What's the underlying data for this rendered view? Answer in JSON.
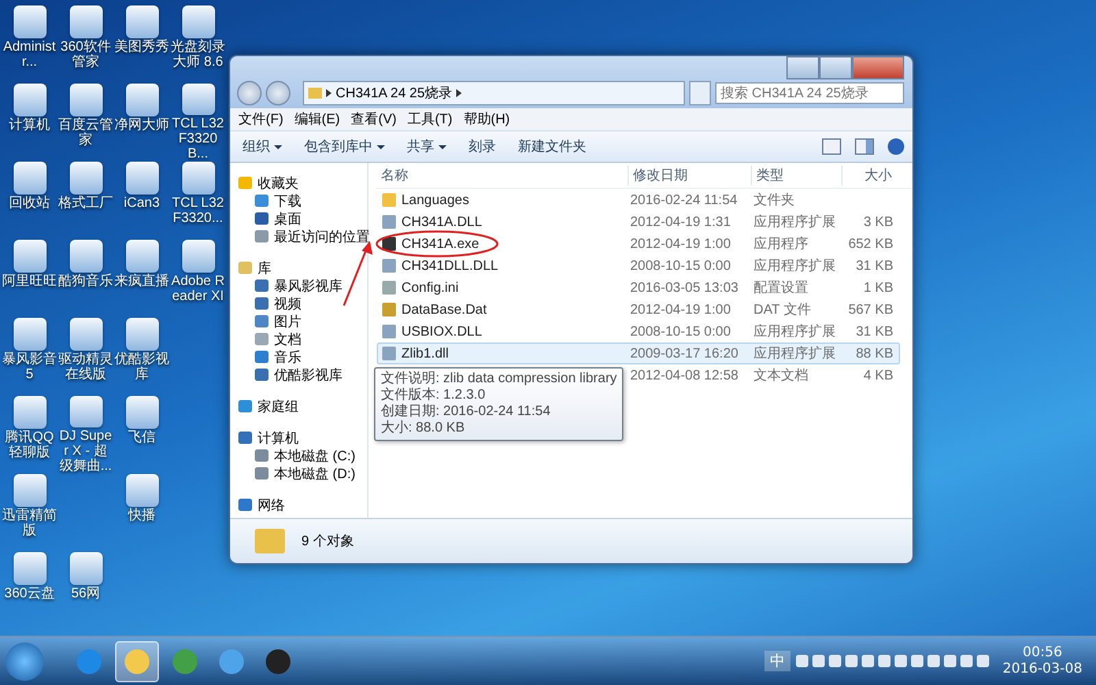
{
  "desktop": {
    "icons": [
      {
        "kind": "app",
        "label": "Administr..."
      },
      {
        "kind": "app",
        "label": "计算机"
      },
      {
        "kind": "app",
        "label": "回收站"
      },
      {
        "kind": "app",
        "label": "阿里旺旺"
      },
      {
        "kind": "app",
        "label": "暴风影音5"
      },
      {
        "kind": "app",
        "label": "腾讯QQ轻聊版"
      },
      {
        "kind": "app",
        "label": "迅雷精简版"
      },
      {
        "kind": "app",
        "label": "360云盘"
      },
      {
        "kind": "app",
        "label": "360软件管家"
      },
      {
        "kind": "app",
        "label": "百度云管家"
      },
      {
        "kind": "app",
        "label": "格式工厂"
      },
      {
        "kind": "app",
        "label": "酷狗音乐"
      },
      {
        "kind": "app",
        "label": "驱动精灵在线版"
      },
      {
        "kind": "app",
        "label": "DJ Super X - 超级舞曲..."
      },
      {
        "kind": "blank"
      },
      {
        "kind": "app",
        "label": "56网"
      },
      {
        "kind": "app",
        "label": "美图秀秀"
      },
      {
        "kind": "app",
        "label": "净网大师"
      },
      {
        "kind": "app",
        "label": "iCan3"
      },
      {
        "kind": "app",
        "label": "来疯直播"
      },
      {
        "kind": "app",
        "label": "优酷影视库"
      },
      {
        "kind": "app",
        "label": "飞信"
      },
      {
        "kind": "app",
        "label": "快播"
      },
      {
        "kind": "blank"
      },
      {
        "kind": "app",
        "label": "光盘刻录大师 8.6"
      },
      {
        "kind": "app",
        "label": "TCL L32F3320B..."
      },
      {
        "kind": "app",
        "label": "TCL L32F3320..."
      },
      {
        "kind": "app",
        "label": "Adobe Reader XI"
      }
    ]
  },
  "window": {
    "address": "CH341A 24 25烧录",
    "search": {
      "placeholder": "搜索 CH341A 24 25烧录"
    },
    "menu": [
      "文件(F)",
      "编辑(E)",
      "查看(V)",
      "工具(T)",
      "帮助(H)"
    ],
    "toolbar": [
      {
        "label": "组织",
        "dropdown": true
      },
      {
        "label": "包含到库中",
        "dropdown": true
      },
      {
        "label": "共享",
        "dropdown": true
      },
      {
        "label": "刻录",
        "dropdown": false
      },
      {
        "label": "新建文件夹",
        "dropdown": false
      }
    ],
    "sidebar": [
      {
        "label": "收藏夹",
        "kind": "star",
        "children": [
          {
            "label": "下载",
            "kind": "download"
          },
          {
            "label": "桌面",
            "kind": "desktop"
          },
          {
            "label": "最近访问的位置",
            "kind": "recent"
          }
        ]
      },
      {
        "label": "库",
        "kind": "library",
        "children": [
          {
            "label": "暴风影视库",
            "kind": "video"
          },
          {
            "label": "视频",
            "kind": "video"
          },
          {
            "label": "图片",
            "kind": "picture"
          },
          {
            "label": "文档",
            "kind": "doc"
          },
          {
            "label": "音乐",
            "kind": "music"
          },
          {
            "label": "优酷影视库",
            "kind": "video"
          }
        ]
      },
      {
        "label": "家庭组",
        "kind": "homegroup"
      },
      {
        "label": "计算机",
        "kind": "computer",
        "children": [
          {
            "label": "本地磁盘 (C:)",
            "kind": "drive"
          },
          {
            "label": "本地磁盘 (D:)",
            "kind": "drive"
          }
        ]
      },
      {
        "label": "网络",
        "kind": "network"
      }
    ],
    "columns": [
      "名称",
      "修改日期",
      "类型",
      "大小"
    ],
    "files": [
      {
        "name": "Languages",
        "date": "2016-02-24 11:54",
        "type": "文件夹",
        "kind": "folder",
        "selected": false
      },
      {
        "name": "CH341A.DLL",
        "date": "2012-04-19 1:31",
        "type": "应用程序扩展",
        "size": "3 KB",
        "kind": "dll",
        "selected": false
      },
      {
        "name": "CH341A.exe",
        "date": "2012-04-19 1:00",
        "type": "应用程序",
        "size": "652 KB",
        "kind": "exe",
        "selected": false
      },
      {
        "name": "CH341DLL.DLL",
        "date": "2008-10-15 0:00",
        "type": "应用程序扩展",
        "size": "31 KB",
        "kind": "dll",
        "selected": false
      },
      {
        "name": "Config.ini",
        "date": "2016-03-05 13:03",
        "type": "配置设置",
        "size": "1 KB",
        "kind": "ini",
        "selected": false
      },
      {
        "name": "DataBase.Dat",
        "date": "2012-04-19 1:00",
        "type": "DAT 文件",
        "size": "567 KB",
        "kind": "dat",
        "selected": false
      },
      {
        "name": "USBIOX.DLL",
        "date": "2008-10-15 0:00",
        "type": "应用程序扩展",
        "size": "31 KB",
        "kind": "dll",
        "selected": false
      },
      {
        "name": "Zlib1.dll",
        "date": "2009-03-17 16:20",
        "type": "应用程序扩展",
        "size": "88 KB",
        "kind": "dll",
        "selected": true
      },
      {
        "date": "2012-04-08 12:58",
        "type": "文本文档",
        "size": "4 KB",
        "kind": "txt",
        "selected": false
      }
    ],
    "tooltip": [
      "文件说明: zlib data compression library",
      "文件版本: 1.2.3.0",
      "创建日期: 2016-02-24 11:54",
      "大小: 88.0 KB"
    ],
    "status": "9 个对象"
  },
  "taskbar": {
    "apps": [
      {
        "kind": "ie",
        "selected": false
      },
      {
        "kind": "explorer",
        "selected": true
      },
      {
        "kind": "green",
        "selected": false
      },
      {
        "kind": "blue",
        "selected": false
      },
      {
        "kind": "qq",
        "selected": false
      }
    ],
    "language": "中",
    "time": "00:56",
    "date": "2016-03-08"
  }
}
